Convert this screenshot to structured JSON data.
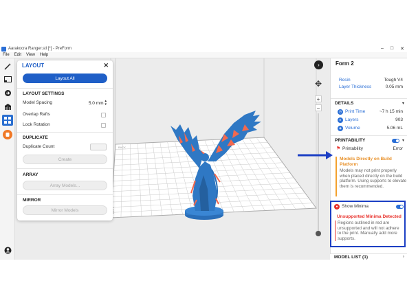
{
  "window": {
    "title": "Aarakocra Ranger.stl [*] - PreForm",
    "controls": [
      "–",
      "□",
      "✕"
    ]
  },
  "menubar": [
    "File",
    "Edit",
    "View",
    "Help"
  ],
  "toolbar_icons": [
    "magic-wand-icon",
    "select-box-icon",
    "orient-icon",
    "supports-icon",
    "layout-grid-icon",
    "print-icon"
  ],
  "layout_panel": {
    "title": "LAYOUT",
    "close": "✕",
    "layout_all": "Layout All",
    "settings_head": "LAYOUT SETTINGS",
    "model_spacing_label": "Model Spacing",
    "model_spacing_value": "5.0 mm",
    "overlap_rafts_label": "Overlap Rafts",
    "lock_rotation_label": "Lock Rotation",
    "duplicate_head": "DUPLICATE",
    "duplicate_count_label": "Duplicate Count",
    "create": "Create",
    "array_head": "ARRAY",
    "array_models": "Array Models...",
    "mirror_head": "MIRROR",
    "mirror_models": "Mirror Models"
  },
  "right_panel": {
    "printer": "Form 2",
    "resin_label": "Resin",
    "resin_value": "Tough V4",
    "layer_label": "Layer Thickness",
    "layer_value": "0.05 mm",
    "details_head": "DETAILS",
    "print_time_label": "Print Time",
    "print_time_value": "~7 h 15 min",
    "layers_label": "Layers",
    "layers_value": "903",
    "volume_label": "Volume",
    "volume_value": "5.06 mL",
    "printability_head": "PRINTABILITY",
    "printability_label": "Printability",
    "printability_value": "Error",
    "warn_title": "Models Directly on Build Platform",
    "warn_text": "Models may not print properly when placed directly on the build platform. Using supports to elevate them is recommended.",
    "show_minima": "Show Minima",
    "minima_title": "Unsupported Minima Detected",
    "minima_text": "Regions outlined in red are unsupported and will not adhere to the print. Manually add more supports.",
    "model_list": "MODEL LIST (1)"
  },
  "colors": {
    "accent": "#1f5fc7",
    "warning": "#f3a12d",
    "error": "#e8302a",
    "annotation": "#1c3fc4",
    "model": "#2f78c4",
    "minima": "#f2694f"
  }
}
